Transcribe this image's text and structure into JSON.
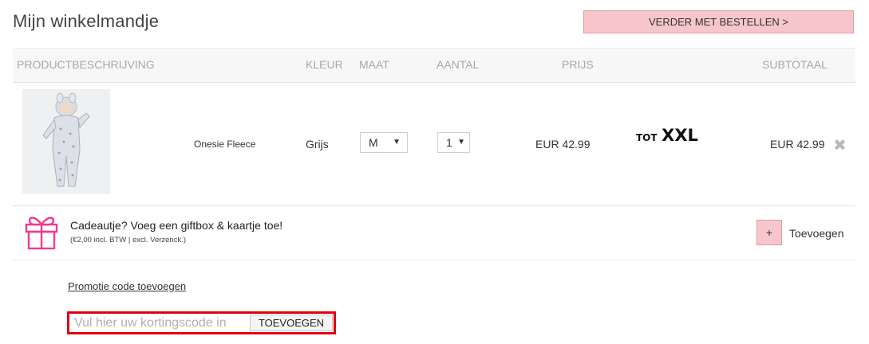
{
  "page": {
    "title": "Mijn winkelmandje",
    "checkout_button": "VERDER MET BESTELLEN >"
  },
  "table": {
    "headers": {
      "product": "PRODUCTBESCHRIJVING",
      "color": "KLEUR",
      "size": "MAAT",
      "quantity": "AANTAL",
      "price": "PRIJS",
      "subtotal": "SUBTOTAAL"
    },
    "item": {
      "name": "Onesie Fleece",
      "color": "Grijs",
      "size": "M",
      "quantity": "1",
      "price": "EUR 42.99",
      "badge_small": "TOT",
      "badge_big": "XXL",
      "subtotal": "EUR 42.99",
      "remove_icon": "close-icon"
    }
  },
  "gift": {
    "icon": "gift-icon",
    "title": "Cadeautje? Voeg een giftbox & kaartje toe!",
    "subtitle": "(€2,00 incl. BTW | excl. Verzenck.)",
    "add_symbol": "+",
    "add_label": "Toevoegen"
  },
  "promo": {
    "link": "Promotie code toevoegen",
    "placeholder": "Vul hier uw kortingscode in",
    "value": "",
    "button": "TOEVOEGEN"
  },
  "colors": {
    "accent_pink": "#f6c6cb",
    "accent_border": "#e29aa2",
    "gift_pink": "#ee3a93",
    "highlight_red": "#e0000f"
  }
}
